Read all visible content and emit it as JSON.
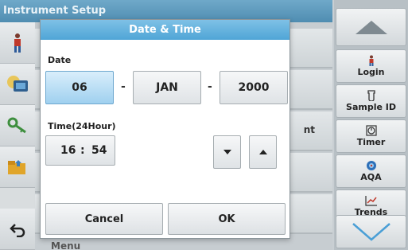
{
  "background": {
    "title": "Instrument Setup",
    "row_text": "nt",
    "bottom_text": "Menu"
  },
  "dialog": {
    "title": "Date & Time",
    "date_label": "Date",
    "day": "06",
    "month": "JAN",
    "year": "2000",
    "date_separator": "-",
    "time_label": "Time(24Hour)",
    "hour": "16",
    "time_separator": ":",
    "minute": "54",
    "cancel_label": "Cancel",
    "ok_label": "OK"
  },
  "sidebar": {
    "items": [
      {
        "label": "Login",
        "icon": "person-icon"
      },
      {
        "label": "Sample ID",
        "icon": "sample-icon"
      },
      {
        "label": "Timer",
        "icon": "timer-icon"
      },
      {
        "label": "AQA",
        "icon": "aqa-icon"
      },
      {
        "label": "Trends",
        "icon": "trends-icon"
      }
    ]
  },
  "colors": {
    "title_bar": "#4fa5d6",
    "active_field": "#9fd0ef",
    "arrow": "#4a9fd6"
  }
}
